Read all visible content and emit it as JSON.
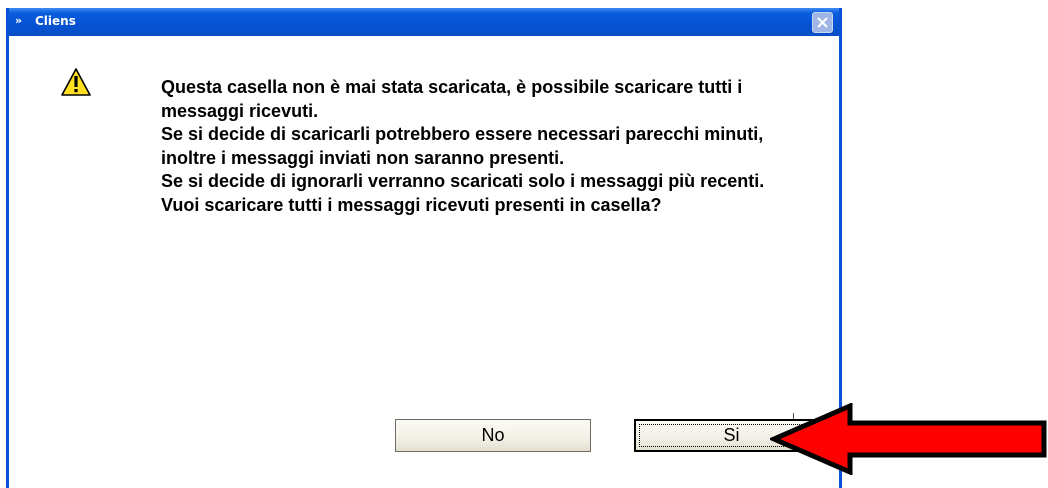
{
  "window": {
    "title": "Cliens",
    "app_icon": "»"
  },
  "icons": {
    "close": "close-icon",
    "warning": "warning-icon",
    "arrow": "red-arrow-annotation"
  },
  "message": {
    "paragraphs": [
      "Questa casella non è mai stata scaricata, è possibile scaricare tutti i messaggi ricevuti.",
      "Se si decide di scaricarli potrebbero essere necessari parecchi minuti, inoltre i messaggi inviati non saranno presenti.",
      "Se si decide di ignorarli verranno scaricati solo i messaggi più recenti.",
      "Vuoi scaricare tutti i messaggi ricevuti presenti in casella?"
    ]
  },
  "buttons": {
    "no_label": "No",
    "si_label": "Si"
  },
  "colors": {
    "titlebar": "#0553d2",
    "arrow_fill": "#ff0000",
    "arrow_outline": "#000000"
  }
}
